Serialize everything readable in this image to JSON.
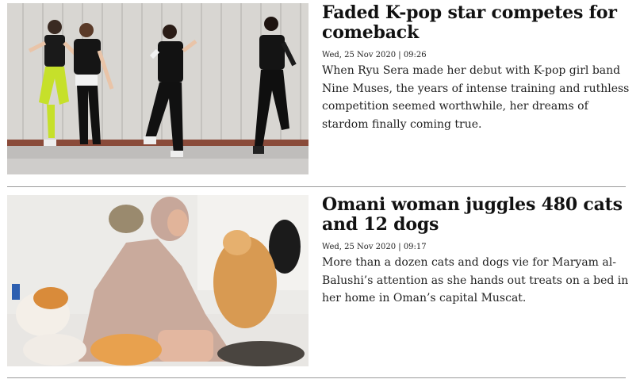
{
  "articles": [
    {
      "headline": "Faded K-pop star competes for comeback",
      "date": "Wed, 25 Nov 2020 | 09:26",
      "summary": "When Ryu Sera made her debut with K-pop girl band Nine Muses, the years of intense training and ruthless competition seemed worthwhile, her dreams of stardom finally coming true.",
      "image_subject": "dancers-photo"
    },
    {
      "headline": "Omani woman juggles 480 cats and 12 dogs",
      "date": "Wed, 25 Nov 2020 | 09:17",
      "summary": "More than a dozen cats and dogs vie for Maryam al-Balushi’s attention as she hands out treats on a bed in her home in Oman’s capital Muscat.",
      "image_subject": "cats-dogs-photo"
    }
  ],
  "colors": {
    "headline": "#111111",
    "body_text": "#222222",
    "divider": "#9a9a9a"
  }
}
